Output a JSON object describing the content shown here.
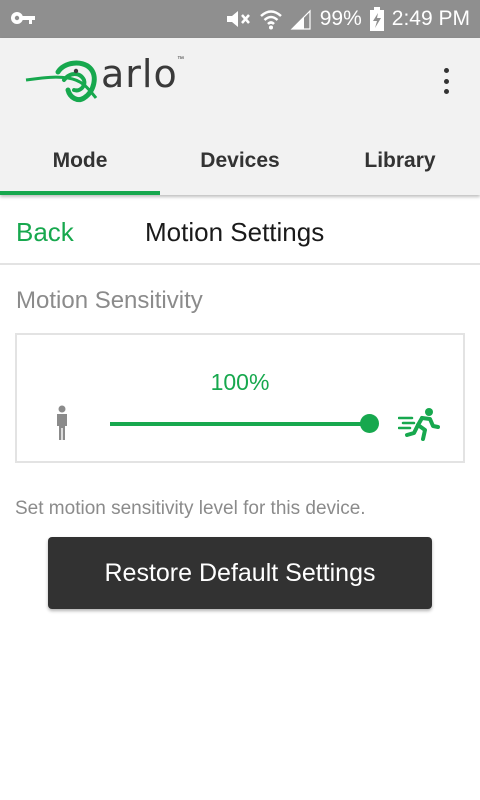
{
  "status_bar": {
    "battery_percent": "99%",
    "time": "2:49 PM",
    "icons": [
      "key-icon",
      "mute-icon",
      "wifi-icon",
      "cell-signal-icon",
      "battery-charging-icon"
    ]
  },
  "app_bar": {
    "logo_text": "arlo",
    "logo_tm": "™",
    "menu_icon": "overflow-menu-icon"
  },
  "tabs": [
    {
      "label": "Mode",
      "active": true
    },
    {
      "label": "Devices",
      "active": false
    },
    {
      "label": "Library",
      "active": false
    }
  ],
  "header": {
    "back_label": "Back",
    "title": "Motion Settings"
  },
  "motion_sensitivity": {
    "label": "Motion Sensitivity",
    "value_text": "100%",
    "value_fraction": 1.0,
    "min_icon": "person-standing-icon",
    "max_icon": "person-running-icon"
  },
  "help_text": "Set motion sensitivity level for this device.",
  "restore_button_label": "Restore Default Settings",
  "colors": {
    "accent": "#17a84e",
    "status_bar": "#8f8f8f",
    "button": "#323232"
  }
}
